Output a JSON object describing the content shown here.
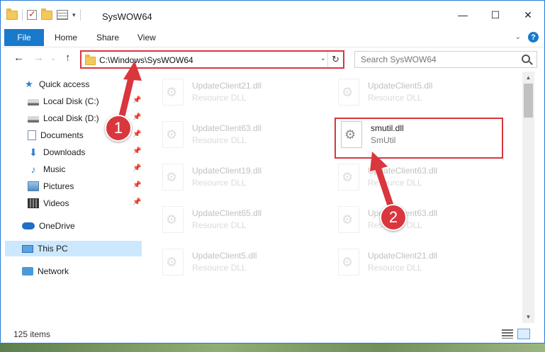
{
  "window": {
    "title": "SysWOW64"
  },
  "ribbon": {
    "file": "File",
    "home": "Home",
    "share": "Share",
    "view": "View"
  },
  "address": {
    "path": "C:\\Windows\\SysWOW64"
  },
  "search": {
    "placeholder": "Search SysWOW64"
  },
  "sidebar": {
    "items": [
      {
        "label": "Quick access"
      },
      {
        "label": "Local Disk (C:)"
      },
      {
        "label": "Local Disk (D:)"
      },
      {
        "label": "Documents"
      },
      {
        "label": "Downloads"
      },
      {
        "label": "Music"
      },
      {
        "label": "Pictures"
      },
      {
        "label": "Videos"
      },
      {
        "label": "OneDrive"
      },
      {
        "label": "This PC"
      },
      {
        "label": "Network"
      }
    ]
  },
  "files": [
    {
      "name": "UpdateClient21.dll",
      "type": "Resource DLL"
    },
    {
      "name": "UpdateClient5.dll",
      "type": "Resource DLL"
    },
    {
      "name": "UpdateClient63.dll",
      "type": "Resource DLL"
    },
    {
      "name": "smutil.dll",
      "type": "SmUtil"
    },
    {
      "name": "UpdateClient19.dll",
      "type": "Resource DLL"
    },
    {
      "name": "UpdateClient63.dll",
      "type": "Resource DLL"
    },
    {
      "name": "UpdateClient65.dll",
      "type": "Resource DLL"
    },
    {
      "name": "UpdateClient63.dll",
      "type": "Resource DLL"
    },
    {
      "name": "UpdateClient5.dll",
      "type": "Resource DLL"
    },
    {
      "name": "UpdateClient21.dll",
      "type": "Resource DLL"
    }
  ],
  "status": {
    "count": "125 items"
  },
  "annotations": {
    "step1": "1",
    "step2": "2"
  },
  "colors": {
    "accent": "#1979ca",
    "highlight": "#d9363e",
    "selected": "#cce8ff"
  }
}
